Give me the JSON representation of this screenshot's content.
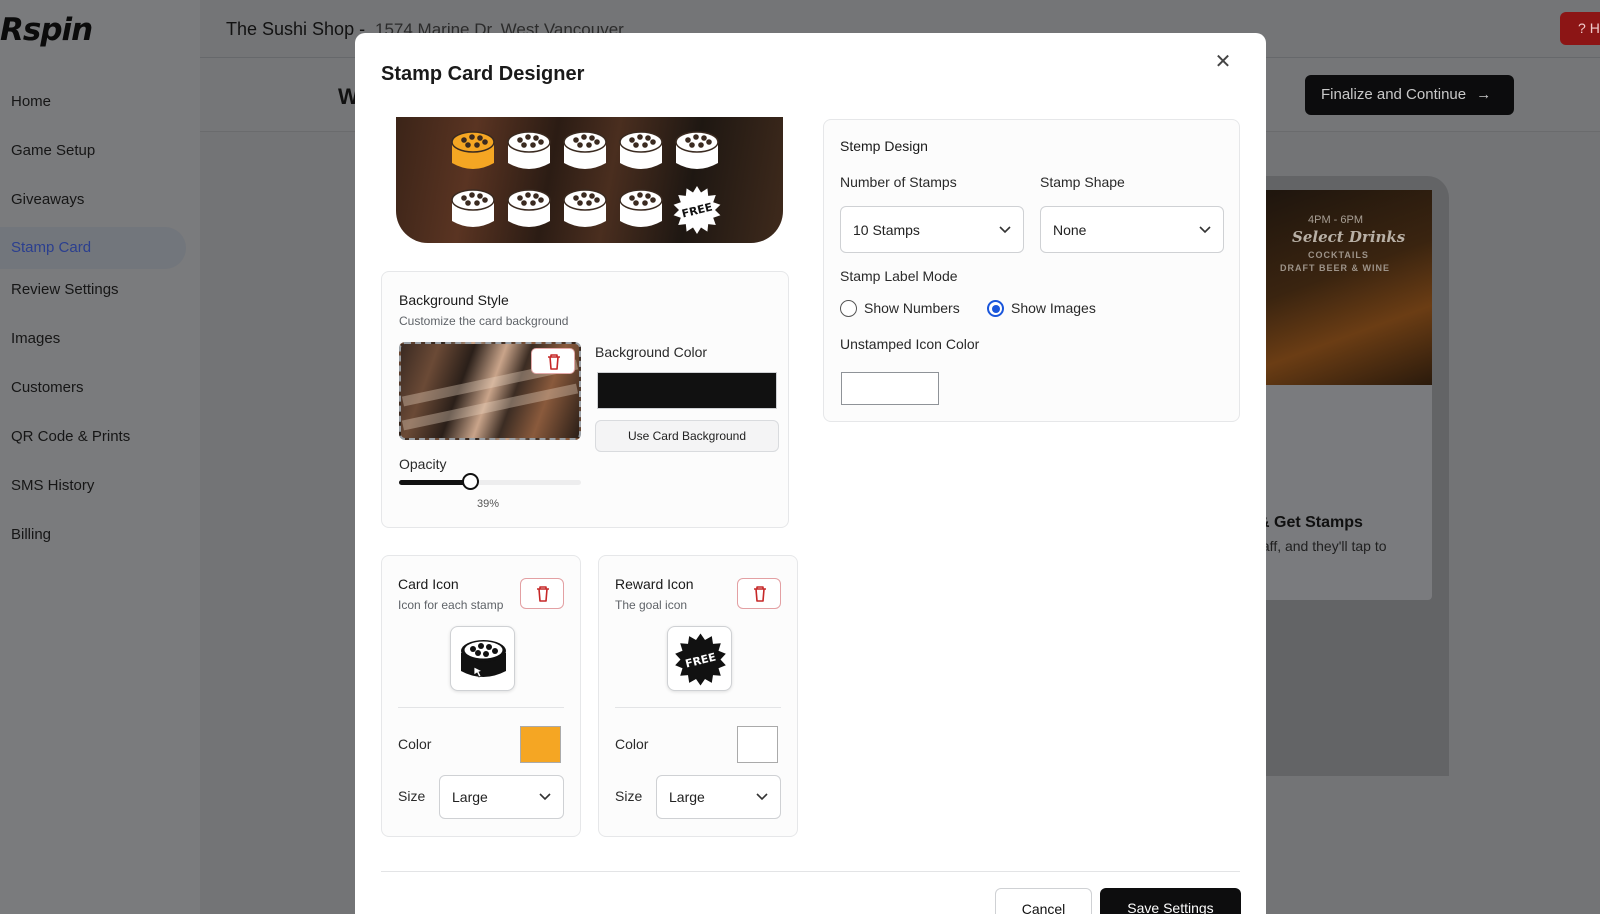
{
  "app": {
    "logo": "Rspin",
    "shop_name": "The Sushi Shop -",
    "shop_address": "1574 Marine Dr, West Vancouver",
    "help_label": "H",
    "page_heading_initial": "W",
    "finalize_label": "Finalize and Continue"
  },
  "sidebar": {
    "items": [
      {
        "label": "Home"
      },
      {
        "label": "Game Setup"
      },
      {
        "label": "Giveaways"
      },
      {
        "label": "Stamp Card",
        "active": true
      },
      {
        "label": "Review Settings"
      },
      {
        "label": "Images"
      },
      {
        "label": "Customers"
      },
      {
        "label": "QR Code & Prints"
      },
      {
        "label": "SMS History"
      },
      {
        "label": "Billing"
      }
    ]
  },
  "preview": {
    "time": "4PM - 6PM",
    "promo": "Select Drinks",
    "line1": "COCKTAILS",
    "line2": "DRAFT BEER & WINE",
    "heading": "& Get Stamps",
    "text": "taff, and they'll tap to"
  },
  "modal": {
    "title": "Stamp Card Designer",
    "close_icon": "close-icon",
    "banner": {
      "stamps_total": 10,
      "stamped": 1,
      "stamped_color": "#F5A623",
      "unstamped_color": "#FFFFFF",
      "reward_text": "FREE"
    },
    "background_style": {
      "title": "Background Style",
      "subtitle": "Customize the card background",
      "color_label": "Background Color",
      "color": "#111111",
      "use_card_bg_label": "Use Card Background",
      "opacity_label": "Opacity",
      "opacity_value": 39,
      "opacity_text": "39%"
    },
    "card_icon": {
      "title": "Card Icon",
      "subtitle": "Icon for each stamp",
      "color_label": "Color",
      "color": "#F5A623",
      "size_label": "Size",
      "size_value": "Large"
    },
    "reward_icon": {
      "title": "Reward Icon",
      "subtitle": "The goal icon",
      "icon_text": "FREE",
      "color_label": "Color",
      "color": "#FFFFFF",
      "size_label": "Size",
      "size_value": "Large"
    },
    "stamp_design": {
      "title": "Stemp Design",
      "num_label": "Number of Stamps",
      "num_value": "10 Stamps",
      "shape_label": "Stamp Shape",
      "shape_value": "None",
      "label_mode_label": "Stamp Label Mode",
      "option_numbers": "Show Numbers",
      "option_images": "Show Images",
      "selected_mode": "Show Images",
      "unstamped_label": "Unstamped Icon Color",
      "unstamped_color": "#FFFFFF"
    },
    "cancel_label": "Cancel",
    "save_label": "Save Settings"
  }
}
